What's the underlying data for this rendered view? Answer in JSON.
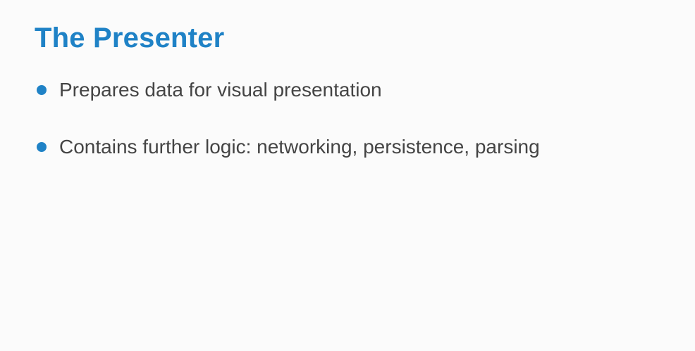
{
  "slide": {
    "title": "The Presenter",
    "accent_color": "#1f82c6",
    "text_color": "#444444",
    "background_color": "#fbfbfb",
    "bullets": [
      {
        "text": "Prepares data for visual presentation"
      },
      {
        "text": "Contains further logic: networking, persistence, parsing"
      }
    ]
  }
}
